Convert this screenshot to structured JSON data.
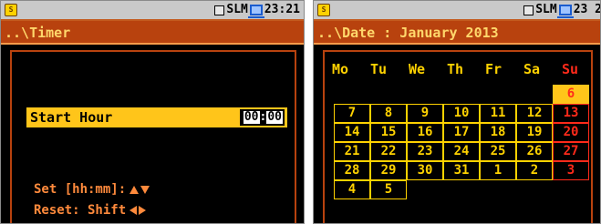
{
  "left_screen": {
    "status": {
      "label": "SLM",
      "time": "23:21"
    },
    "path": "..\\Timer",
    "start_hour": {
      "label": "Start Hour",
      "hours": "00",
      "separator": ":",
      "minutes": "00"
    },
    "hint_set": "Set [hh:mm]:",
    "hint_reset": "Reset: Shift"
  },
  "right_screen": {
    "status": {
      "label": "SLM",
      "time": "23 2"
    },
    "path": "..\\Date : January 2013",
    "weekdays": [
      "Mo",
      "Tu",
      "We",
      "Th",
      "Fr",
      "Sa",
      "Su"
    ],
    "weeks": [
      [
        "",
        "",
        "",
        "",
        "",
        "",
        "6"
      ],
      [
        "7",
        "8",
        "9",
        "10",
        "11",
        "12",
        "13"
      ],
      [
        "14",
        "15",
        "16",
        "17",
        "18",
        "19",
        "20"
      ],
      [
        "21",
        "22",
        "23",
        "24",
        "25",
        "26",
        "27"
      ],
      [
        "28",
        "29",
        "30",
        "31",
        "1",
        "2",
        "3"
      ],
      [
        "4",
        "5",
        "",
        "",
        "",
        "",
        ""
      ]
    ],
    "selected_day": "6"
  },
  "colors": {
    "accent": "#b8420e",
    "highlight": "#ffc51a",
    "text_yellow": "#ffd200",
    "sunday_red": "#ff2a1a",
    "hint_orange": "#ff8a3c"
  },
  "icons": [
    "logo-icon",
    "square-icon",
    "monitor-icon",
    "arrow-up-icon",
    "arrow-down-icon",
    "arrow-left-icon",
    "arrow-right-icon"
  ]
}
